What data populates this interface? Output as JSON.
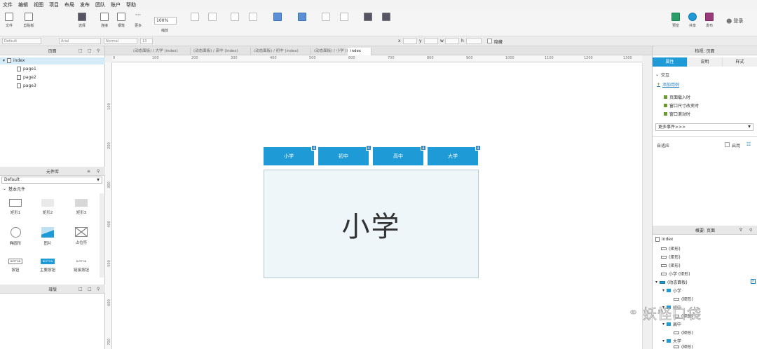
{
  "menu": [
    "文件",
    "编辑",
    "视图",
    "项目",
    "布局",
    "发布",
    "团队",
    "账户",
    "帮助"
  ],
  "toolbar": {
    "items": [
      "文件",
      "剪贴板",
      "选择",
      "连接",
      "钢笔",
      "更多",
      "",
      "",
      "",
      "",
      "",
      "",
      "",
      "",
      "",
      "",
      "",
      "",
      "预览",
      "共享",
      "发布"
    ],
    "zoom": "100%",
    "zoom_label": "缩放",
    "login": "登录"
  },
  "format": {
    "style": "Default",
    "font": "Arial",
    "weight": "Normal",
    "size": "13",
    "x_label": "x",
    "y_label": "y",
    "w_label": "w",
    "h_label": "h",
    "hidden": "隐藏"
  },
  "pages_panel": {
    "title": "页面",
    "root": "index",
    "pages": [
      "page1",
      "page2",
      "page3"
    ]
  },
  "library_panel": {
    "title": "元件库",
    "selected": "Default",
    "section": "基本元件",
    "items": [
      "矩形1",
      "矩形2",
      "矩形3",
      "椭圆形",
      "图片",
      "占位符",
      "按钮",
      "主要按钮",
      "链接按钮"
    ],
    "button_text": "BUTTON"
  },
  "masters_panel": {
    "title": "母版"
  },
  "doc_tabs": [
    "(动态面板) / 大学 (index)",
    "(动态面板) / 高中 (index)",
    "(动态面板) / 初中 (index)",
    "(动态面板) / 小学 (index)",
    "index"
  ],
  "ruler_h": [
    "0",
    "100",
    "200",
    "300",
    "400",
    "500",
    "600",
    "700",
    "800",
    "900",
    "1000",
    "1100",
    "1200",
    "1300"
  ],
  "ruler_v": [
    "100",
    "200",
    "300",
    "400",
    "500",
    "600",
    "700"
  ],
  "prototype": {
    "tabs": [
      "小学",
      "初中",
      "高中",
      "大学"
    ],
    "badge": "4",
    "content": "小学",
    "tab_color": "#1e9ad6"
  },
  "inspector": {
    "title": "检视: 页面",
    "tabs": [
      "属性",
      "说明",
      "样式"
    ],
    "section": "交互",
    "add_case": "添加用例",
    "events": [
      "页面载入时",
      "窗口尺寸改变时",
      "窗口滚动时"
    ],
    "more_events": "更多事件>>>",
    "adaptive": "自适应",
    "enable": "启用"
  },
  "outline": {
    "title": "概要: 页面",
    "root": "index",
    "items": [
      "(矩形)",
      "(矩形)",
      "(矩形)",
      "小学 (矩形)",
      "(动态面板)",
      "小学",
      "(矩形)",
      "初中",
      "(矩形)",
      "高中",
      "(矩形)",
      "大学",
      "(矩形)"
    ]
  },
  "watermark": "妖怪口袋"
}
